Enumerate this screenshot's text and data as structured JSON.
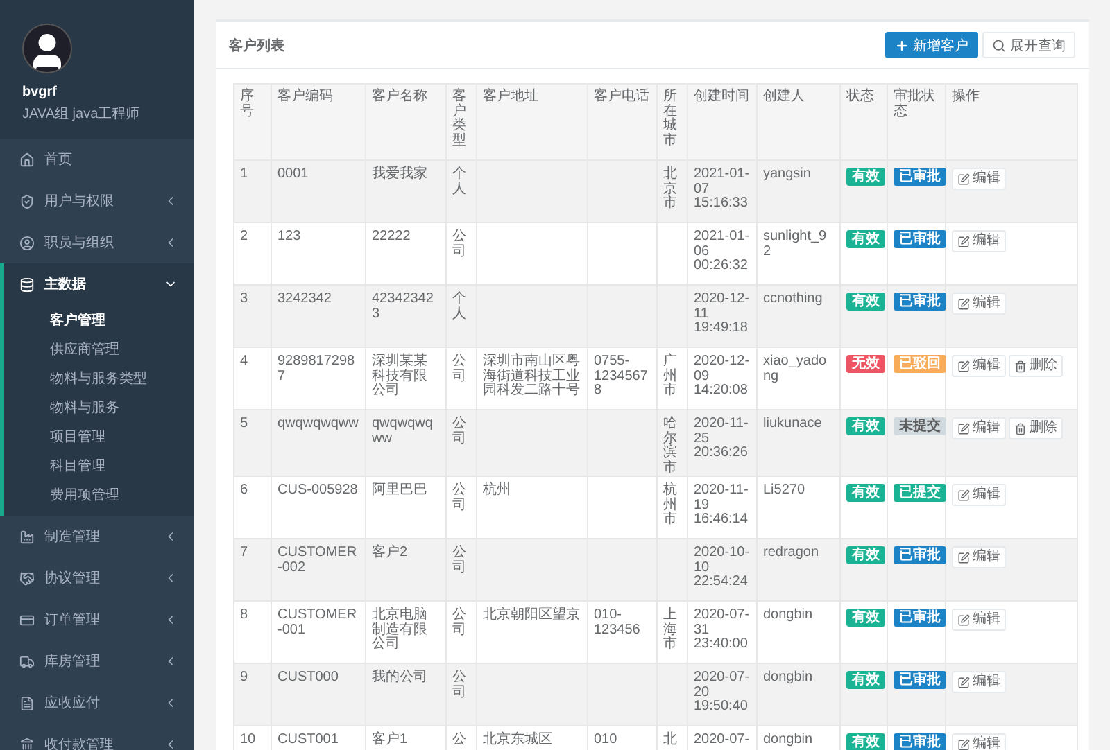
{
  "sidebar": {
    "user": {
      "name": "bvgrf",
      "role": "JAVA组  java工程师"
    },
    "menu": [
      {
        "label": "首页",
        "kind": "link"
      },
      {
        "label": "用户与权限",
        "kind": "group",
        "expanded": false
      },
      {
        "label": "职员与组织",
        "kind": "group",
        "expanded": false
      },
      {
        "label": "主数据",
        "kind": "group",
        "expanded": true,
        "children": [
          {
            "label": "客户管理",
            "selected": true
          },
          {
            "label": "供应商管理",
            "selected": false
          },
          {
            "label": "物料与服务类型",
            "selected": false
          },
          {
            "label": "物料与服务",
            "selected": false
          },
          {
            "label": "项目管理",
            "selected": false
          },
          {
            "label": "科目管理",
            "selected": false
          },
          {
            "label": "费用项管理",
            "selected": false
          }
        ]
      },
      {
        "label": "制造管理",
        "kind": "group",
        "expanded": false
      },
      {
        "label": "协议管理",
        "kind": "group",
        "expanded": false
      },
      {
        "label": "订单管理",
        "kind": "group",
        "expanded": false
      },
      {
        "label": "库房管理",
        "kind": "group",
        "expanded": false
      },
      {
        "label": "应收应付",
        "kind": "group",
        "expanded": false
      },
      {
        "label": "收付款管理",
        "kind": "group",
        "expanded": false
      }
    ]
  },
  "panel": {
    "title": "客户列表",
    "buttons": [
      {
        "label": "新增客户",
        "kind": "primary"
      },
      {
        "label": "展开查询",
        "kind": "search"
      }
    ]
  },
  "table": {
    "columns": [
      "序号",
      "客户编码",
      "客户名称",
      "客户类型",
      "客户地址",
      "客户电话",
      "所在城市",
      "创建时间",
      "创建人",
      "状态",
      "审批状态",
      "操作"
    ],
    "rows": [
      {
        "cells": [
          "1",
          "0001",
          "我爱我家",
          "个人",
          "",
          "",
          "北京市",
          "2021-01-07 15:16:33",
          "yangsin"
        ],
        "status": {
          "label": "有效",
          "kind": "success"
        },
        "approval": {
          "label": "已审批",
          "kind": "primary"
        },
        "actions": [
          {
            "label": "编辑",
            "kind": "edit"
          }
        ]
      },
      {
        "cells": [
          "2",
          "123",
          "22222",
          "公司",
          "",
          "",
          "",
          "2021-01-06 00:26:32",
          "sunlight_92"
        ],
        "status": {
          "label": "有效",
          "kind": "success"
        },
        "approval": {
          "label": "已审批",
          "kind": "primary"
        },
        "actions": [
          {
            "label": "编辑",
            "kind": "edit"
          }
        ]
      },
      {
        "cells": [
          "3",
          "3242342",
          "423423423",
          "个人",
          "",
          "",
          "",
          "2020-12-11 19:49:18",
          "ccnothing"
        ],
        "status": {
          "label": "有效",
          "kind": "success"
        },
        "approval": {
          "label": "已审批",
          "kind": "primary"
        },
        "actions": [
          {
            "label": "编辑",
            "kind": "edit"
          }
        ]
      },
      {
        "cells": [
          "4",
          "92898172987",
          "深圳某某科技有限公司",
          "公司",
          "深圳市南山区粤海街道科技工业园科发二路十号",
          "0755-12345678",
          "广州市",
          "2020-12-09 14:20:08",
          "xiao_yadong"
        ],
        "status": {
          "label": "无效",
          "kind": "danger"
        },
        "approval": {
          "label": "已驳回",
          "kind": "warning"
        },
        "actions": [
          {
            "label": "编辑",
            "kind": "edit"
          },
          {
            "label": "删除",
            "kind": "delete"
          }
        ]
      },
      {
        "cells": [
          "5",
          "qwqwqwqww",
          "qwqwqwqww",
          "公司",
          "",
          "",
          "哈尔滨市",
          "2020-11-25 20:36:26",
          "liukunace"
        ],
        "status": {
          "label": "有效",
          "kind": "success"
        },
        "approval": {
          "label": "未提交",
          "kind": "muted"
        },
        "actions": [
          {
            "label": "编辑",
            "kind": "edit"
          },
          {
            "label": "删除",
            "kind": "delete"
          }
        ]
      },
      {
        "cells": [
          "6",
          "CUS-005928",
          "阿里巴巴",
          "公司",
          "杭州",
          "",
          "杭州市",
          "2020-11-19 16:46:14",
          "Li5270"
        ],
        "status": {
          "label": "有效",
          "kind": "success"
        },
        "approval": {
          "label": "已提交",
          "kind": "success"
        },
        "actions": [
          {
            "label": "编辑",
            "kind": "edit"
          }
        ]
      },
      {
        "cells": [
          "7",
          "CUSTOMER-002",
          "客户2",
          "公司",
          "",
          "",
          "",
          "2020-10-10 22:54:24",
          "redragon"
        ],
        "status": {
          "label": "有效",
          "kind": "success"
        },
        "approval": {
          "label": "已审批",
          "kind": "primary"
        },
        "actions": [
          {
            "label": "编辑",
            "kind": "edit"
          }
        ]
      },
      {
        "cells": [
          "8",
          "CUSTOMER-001",
          "北京电脑制造有限公司",
          "公司",
          "北京朝阳区望京",
          "010-123456",
          "上海市",
          "2020-07-31 23:40:00",
          "dongbin"
        ],
        "status": {
          "label": "有效",
          "kind": "success"
        },
        "approval": {
          "label": "已审批",
          "kind": "primary"
        },
        "actions": [
          {
            "label": "编辑",
            "kind": "edit"
          }
        ]
      },
      {
        "cells": [
          "9",
          "CUST000",
          "我的公司",
          "公司",
          "",
          "",
          "",
          "2020-07-20 19:50:40",
          "dongbin"
        ],
        "status": {
          "label": "有效",
          "kind": "success"
        },
        "approval": {
          "label": "已审批",
          "kind": "primary"
        },
        "actions": [
          {
            "label": "编辑",
            "kind": "edit"
          }
        ]
      },
      {
        "cells": [
          "10",
          "CUST001",
          "客户1",
          "公",
          "北京东城区",
          "010",
          "北",
          "2020-07-",
          "dongbin"
        ],
        "status": {
          "label": "有效",
          "kind": "success"
        },
        "approval": {
          "label": "已审批",
          "kind": "primary"
        },
        "actions": [
          {
            "label": "编辑",
            "kind": "edit"
          }
        ]
      }
    ]
  }
}
